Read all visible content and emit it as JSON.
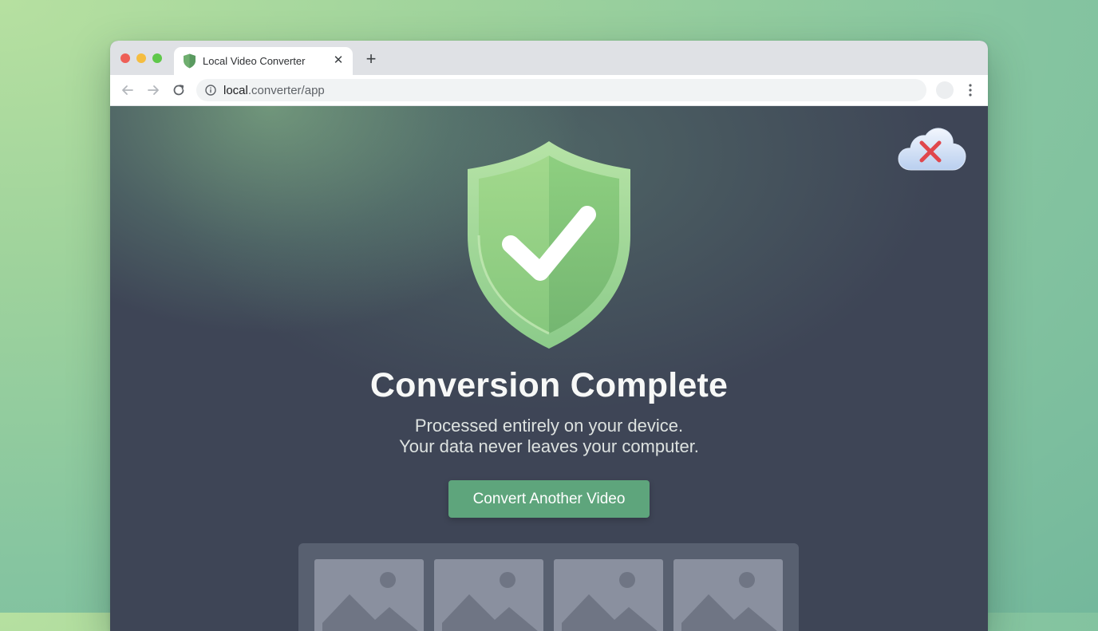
{
  "browser": {
    "tab": {
      "title": "Local Video Converter",
      "favicon": "shield-icon",
      "close_icon": "close-icon"
    },
    "new_tab_icon": "plus-icon",
    "nav": {
      "back_icon": "arrow-left-icon",
      "forward_icon": "arrow-right-icon",
      "reload_icon": "reload-icon"
    },
    "address_bar": {
      "host": "local",
      "path": ".converter/app",
      "info_icon": "info-icon"
    },
    "menu_icon": "vertical-dots-icon"
  },
  "page": {
    "status_icon": "shield-check-icon",
    "cloud_status_icon": "cloud-x-icon",
    "heading": "Conversion Complete",
    "subtitle_line1": "Processed entirely on your device.",
    "subtitle_line2": "Your data never leaves your computer.",
    "cta_label": "Convert Another Video",
    "thumbnail_icon": "image-placeholder-icon"
  },
  "colors": {
    "accent_green": "#5ea57c",
    "shield_green": "#8cc77c",
    "cloud_x_red": "#e0464c",
    "content_bg": "#3e4556"
  }
}
